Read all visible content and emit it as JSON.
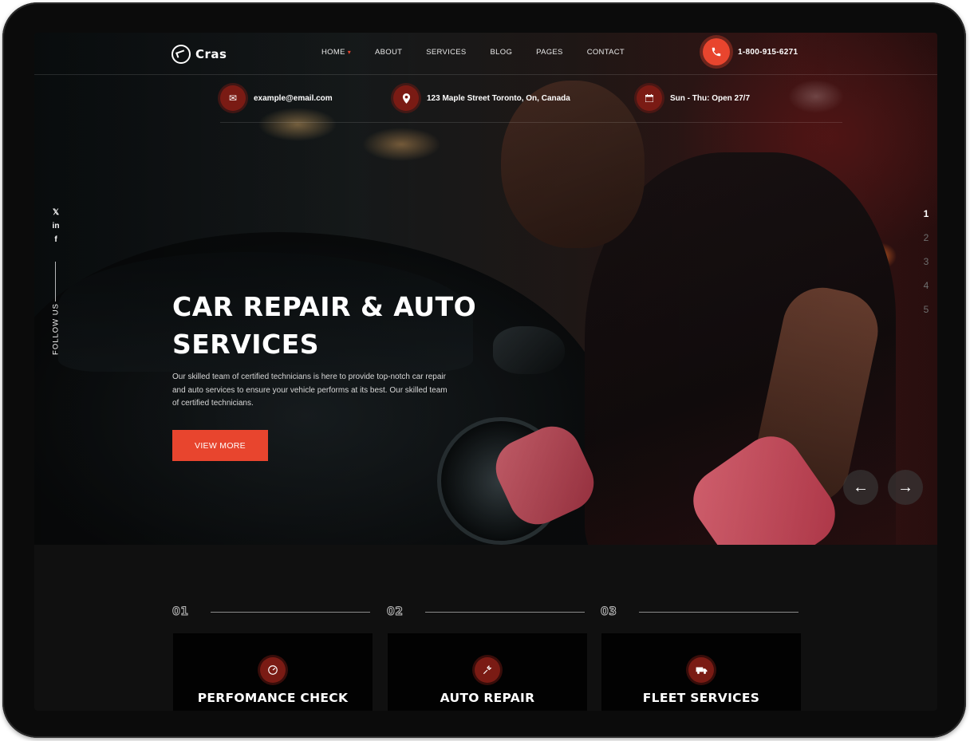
{
  "brand": {
    "name": "Cras"
  },
  "nav": {
    "items": [
      {
        "label": "HOME",
        "has_dropdown": true
      },
      {
        "label": "ABOUT"
      },
      {
        "label": "SERVICES"
      },
      {
        "label": "BLOG"
      },
      {
        "label": "PAGES"
      },
      {
        "label": "CONTACT"
      }
    ],
    "phone": "1-800-915-6271"
  },
  "contact_info": {
    "email": "example@email.com",
    "address": "123 Maple Street Toronto, On, Canada",
    "hours": "Sun - Thu: Open 27/7"
  },
  "follow": {
    "label": "FOLLOW US",
    "socials": [
      "x-icon",
      "linkedin-icon",
      "facebook-icon"
    ]
  },
  "hero": {
    "title_line1": "CAR REPAIR & AUTO",
    "title_line2": "SERVICES",
    "description": "Our skilled team of certified technicians is here to provide top-notch car repair and auto services to ensure your vehicle performs at its best. Our skilled team of certified technicians.",
    "cta": "VIEW MORE"
  },
  "slider": {
    "pages": [
      "1",
      "2",
      "3",
      "4",
      "5"
    ],
    "active": "1",
    "prev_icon": "arrow-left-icon",
    "next_icon": "arrow-right-icon"
  },
  "features": [
    {
      "num": "01",
      "title": "PERFOMANCE CHECK",
      "icon": "speedometer-icon"
    },
    {
      "num": "02",
      "title": "AUTO REPAIR",
      "icon": "repair-tools-icon"
    },
    {
      "num": "03",
      "title": "FLEET SERVICES",
      "icon": "truck-icon"
    }
  ],
  "colors": {
    "accent": "#e8452e",
    "icon_bg": "#7a1b14",
    "page_bg": "#101010"
  }
}
